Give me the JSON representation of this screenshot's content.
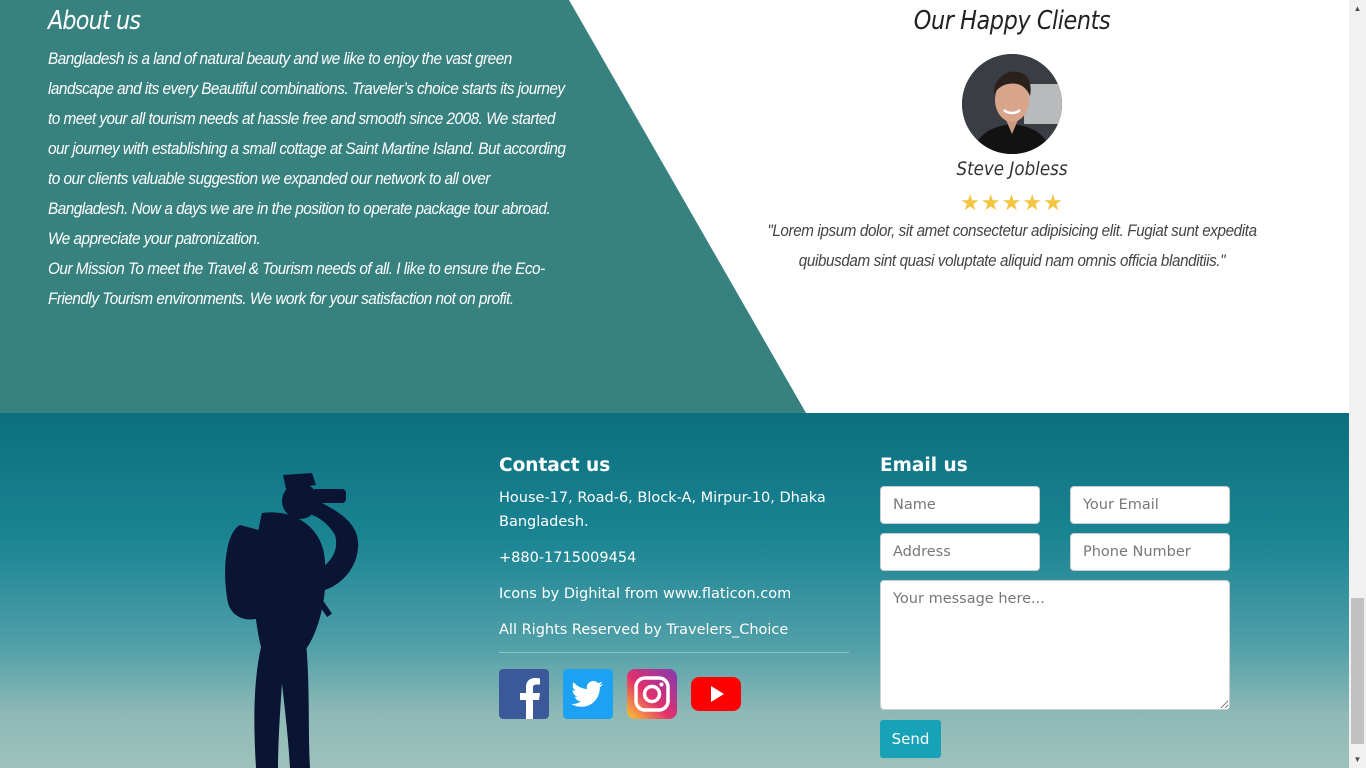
{
  "about": {
    "title": "About us",
    "text": "Bangladesh is a land of natural beauty and we like to enjoy the vast green landscape and its every Beautiful combinations. Traveler’s choice starts its journey to meet your all tourism needs at hassle free and smooth since 2008. We started our journey with establishing a small cottage at Saint Martine Island. But according to our clients valuable suggestion we expanded our network to all over Bangladesh. Now a days we are in the position to operate package tour abroad. We appreciate your patronization.",
    "mission": "Our Mission To meet the Travel & Tourism needs of all. I like to ensure the Eco- Friendly Tourism environments. We work for your satisfaction not on profit."
  },
  "clients": {
    "title": "Our Happy Clients",
    "name": "Steve Jobless",
    "rating": 5,
    "stars": "★★★★★",
    "quote": "\"Lorem ipsum dolor, sit amet consectetur adipisicing elit. Fugiat sunt expedita quibusdam sint quasi voluptate aliquid nam omnis officia blanditiis.\""
  },
  "contact": {
    "title": "Contact us",
    "address": "House-17, Road-6, Block-A, Mirpur-10, Dhaka Bangladesh.",
    "phone": "+880-1715009454",
    "credits": "Icons by Dighital from www.flaticon.com",
    "rights": "All Rights Reserved by Travelers_Choice",
    "social": [
      "facebook-icon",
      "twitter-icon",
      "instagram-icon",
      "youtube-icon"
    ]
  },
  "email": {
    "title": "Email us",
    "name_placeholder": "Name",
    "email_placeholder": "Your Email",
    "address_placeholder": "Address",
    "phone_placeholder": "Phone Number",
    "message_placeholder": "Your message here...",
    "send_label": "Send"
  },
  "colors": {
    "teal": "#37817f",
    "accent": "#17a2b8",
    "star": "#f4c542"
  }
}
